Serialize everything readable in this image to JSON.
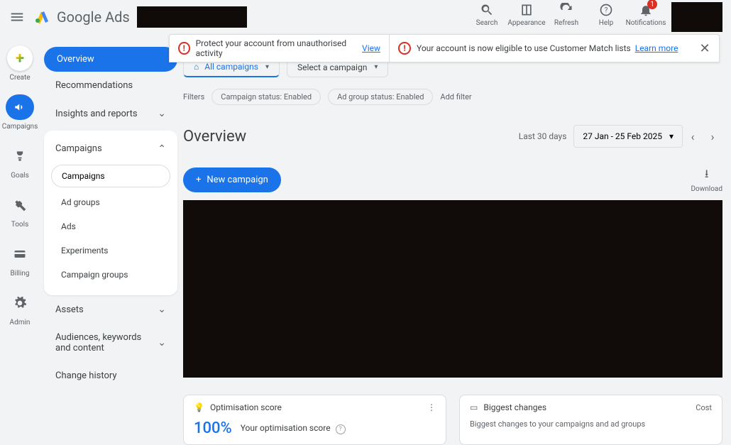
{
  "header": {
    "product": "Google Ads",
    "actions": {
      "search": "Search",
      "appearance": "Appearance",
      "refresh": "Refresh",
      "help": "Help",
      "notifications": "Notifications",
      "notif_count": "1"
    }
  },
  "alerts": {
    "a1_text": "Protect your account from unauthorised activity",
    "a1_link": "View",
    "a2_text": "Your account is now eligible to use Customer Match lists",
    "a2_link": "Learn more"
  },
  "rail": {
    "create": "Create",
    "campaigns": "Campaigns",
    "goals": "Goals",
    "tools": "Tools",
    "billing": "Billing",
    "admin": "Admin"
  },
  "sidenav": {
    "overview": "Overview",
    "recommendations": "Recommendations",
    "insights": "Insights and reports",
    "campaigns": {
      "header": "Campaigns",
      "items": {
        "campaigns": "Campaigns",
        "ad_groups": "Ad groups",
        "ads": "Ads",
        "experiments": "Experiments",
        "campaign_groups": "Campaign groups"
      }
    },
    "assets": "Assets",
    "audiences": "Audiences, keywords and content",
    "change_history": "Change history"
  },
  "main": {
    "tab_all": "All campaigns",
    "tab_select": "Select a campaign",
    "filters_label": "Filters",
    "chip_campaign": "Campaign status: Enabled",
    "chip_adgroup": "Ad group status: Enabled",
    "add_filter": "Add filter",
    "title": "Overview",
    "date_label": "Last 30 days",
    "date_range": "27 Jan - 25 Feb 2025",
    "new_campaign": "New campaign",
    "download": "Download"
  },
  "cards": {
    "opt": {
      "title": "Optimisation score",
      "score": "100%",
      "sub": "Your optimisation score"
    },
    "changes": {
      "title": "Biggest changes",
      "cost": "Cost",
      "sub": "Biggest changes to your campaigns and ad groups"
    }
  }
}
